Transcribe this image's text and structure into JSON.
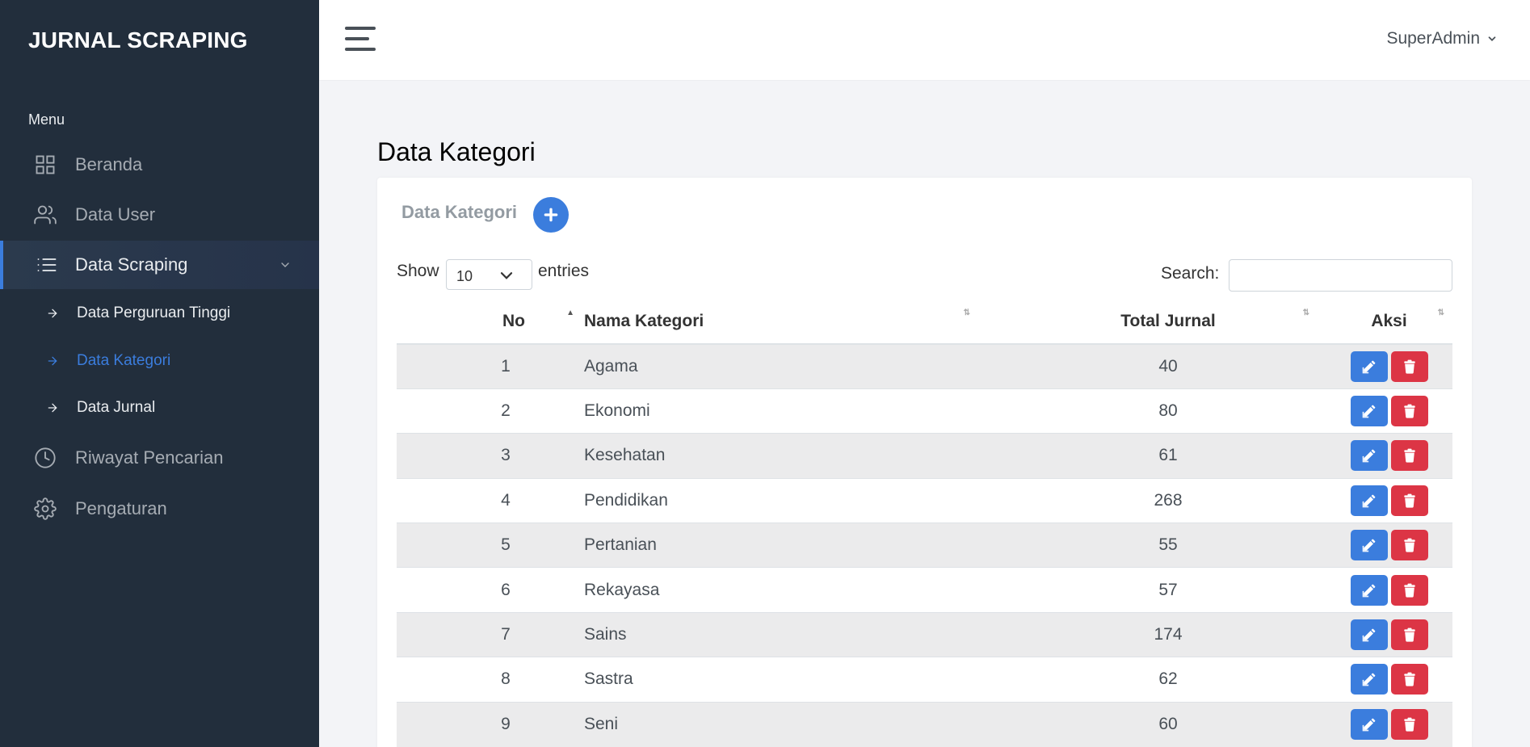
{
  "brand": "JURNAL SCRAPING",
  "sidebar": {
    "menu_header": "Menu",
    "items": [
      {
        "label": "Beranda",
        "icon": "grid-icon"
      },
      {
        "label": "Data User",
        "icon": "users-icon"
      },
      {
        "label": "Data Scraping",
        "icon": "list-icon",
        "active": true
      },
      {
        "label": "Riwayat Pencarian",
        "icon": "clock-icon"
      },
      {
        "label": "Pengaturan",
        "icon": "gear-icon"
      }
    ],
    "sub_items": [
      {
        "label": "Data Perguruan Tinggi"
      },
      {
        "label": "Data Kategori",
        "active": true
      },
      {
        "label": "Data Jurnal"
      }
    ]
  },
  "topbar": {
    "user": "SuperAdmin"
  },
  "page": {
    "title": "Data Kategori",
    "card_title": "Data Kategori"
  },
  "table_controls": {
    "show_label": "Show",
    "page_length": "10",
    "entries_label": "entries",
    "search_label": "Search:",
    "search_value": ""
  },
  "table": {
    "columns": [
      "No",
      "Nama Kategori",
      "Total Jurnal",
      "Aksi"
    ],
    "rows": [
      {
        "no": "1",
        "nama": "Agama",
        "total": "40"
      },
      {
        "no": "2",
        "nama": "Ekonomi",
        "total": "80"
      },
      {
        "no": "3",
        "nama": "Kesehatan",
        "total": "61"
      },
      {
        "no": "4",
        "nama": "Pendidikan",
        "total": "268"
      },
      {
        "no": "5",
        "nama": "Pertanian",
        "total": "55"
      },
      {
        "no": "6",
        "nama": "Rekayasa",
        "total": "57"
      },
      {
        "no": "7",
        "nama": "Sains",
        "total": "174"
      },
      {
        "no": "8",
        "nama": "Sastra",
        "total": "62"
      },
      {
        "no": "9",
        "nama": "Seni",
        "total": "60"
      }
    ]
  },
  "colors": {
    "sidebar_bg": "#222e3c",
    "primary": "#3b7ddd",
    "danger": "#dc3545"
  }
}
